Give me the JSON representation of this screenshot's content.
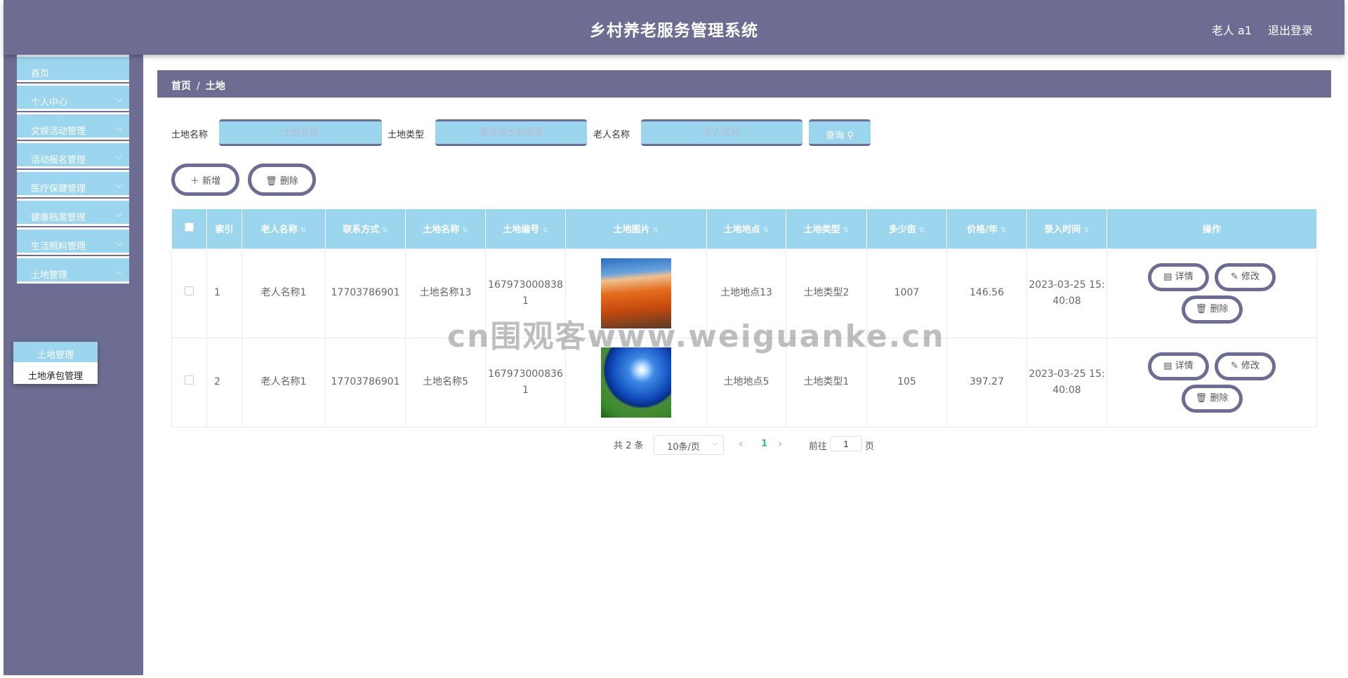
{
  "header": {
    "title": "乡村养老服务管理系统",
    "user": "老人 a1",
    "logout": "退出登录"
  },
  "sidebar": {
    "items": [
      {
        "label": "首页",
        "expandable": false
      },
      {
        "label": "个人中心",
        "expandable": true
      },
      {
        "label": "文娱活动管理",
        "expandable": true
      },
      {
        "label": "活动报名管理",
        "expandable": true
      },
      {
        "label": "医疗保健管理",
        "expandable": true
      },
      {
        "label": "健康档案管理",
        "expandable": true
      },
      {
        "label": "生活照料管理",
        "expandable": true
      },
      {
        "label": "土地管理",
        "expandable": true
      }
    ],
    "submenu": [
      "土地管理",
      "土地承包管理"
    ]
  },
  "breadcrumb": {
    "home": "首页",
    "sep": "/",
    "current": "土地"
  },
  "search": {
    "land_name_label": "土地名称",
    "land_name_placeholder": "土地名称",
    "land_type_label": "土地类型",
    "land_type_placeholder": "请选择土地类型",
    "elder_name_label": "老人名称",
    "elder_name_placeholder": "老人名称",
    "query_label": "查询"
  },
  "actions": {
    "add": "新增",
    "delete": "删除"
  },
  "table": {
    "headers": [
      "索引",
      "老人名称",
      "联系方式",
      "土地名称",
      "土地编号",
      "土地图片",
      "土地地点",
      "土地类型",
      "多少亩",
      "价格/年",
      "录入时间",
      "操作"
    ],
    "rows": [
      {
        "index": "1",
        "elder": "老人名称1",
        "phone": "17703786901",
        "land_name": "土地名称13",
        "land_no": "1679730008381",
        "location": "土地地点13",
        "type": "土地类型2",
        "mu": "1007",
        "price": "146.56",
        "time": "2023-03-25 15:40:08"
      },
      {
        "index": "2",
        "elder": "老人名称1",
        "phone": "17703786901",
        "land_name": "土地名称5",
        "land_no": "1679730008361",
        "location": "土地地点5",
        "type": "土地类型1",
        "mu": "105",
        "price": "397.27",
        "time": "2023-03-25 15:40:08"
      }
    ],
    "ops": {
      "detail": "详情",
      "edit": "修改",
      "delete": "删除"
    }
  },
  "pagination": {
    "total": "共 2 条",
    "page_size": "10条/页",
    "current": "1",
    "goto": "前往",
    "goto_value": "1",
    "page_suffix": "页"
  },
  "watermark": "cn围观客www.weiguanke.cn",
  "colors": {
    "primary": "#6d6c92",
    "accent": "#9cd5ee",
    "active_page": "#3bbf74"
  }
}
